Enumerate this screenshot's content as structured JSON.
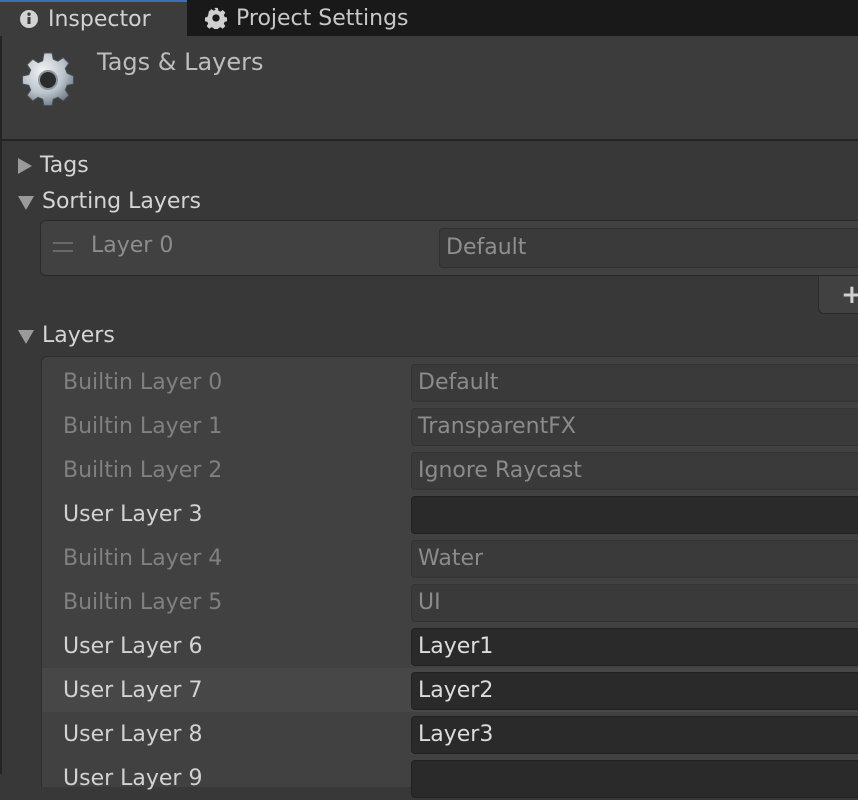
{
  "tabs": [
    {
      "label": "Inspector",
      "icon": "info-icon",
      "active": true
    },
    {
      "label": "Project Settings",
      "icon": "gear-icon",
      "active": false
    }
  ],
  "header": {
    "title": "Tags & Layers",
    "icon": "gear-settings-icon"
  },
  "sections": {
    "tags": {
      "label": "Tags",
      "expanded": false
    },
    "sorting_layers": {
      "label": "Sorting Layers",
      "expanded": true,
      "items": [
        {
          "name": "Layer 0",
          "value": "Default"
        }
      ],
      "add_icon": "plus-icon"
    },
    "layers": {
      "label": "Layers",
      "expanded": true,
      "items": [
        {
          "name": "Builtin Layer 0",
          "value": "Default",
          "builtin": true
        },
        {
          "name": "Builtin Layer 1",
          "value": "TransparentFX",
          "builtin": true
        },
        {
          "name": "Builtin Layer 2",
          "value": "Ignore Raycast",
          "builtin": true
        },
        {
          "name": "User Layer 3",
          "value": "",
          "builtin": false
        },
        {
          "name": "Builtin Layer 4",
          "value": "Water",
          "builtin": true
        },
        {
          "name": "Builtin Layer 5",
          "value": "UI",
          "builtin": true
        },
        {
          "name": "User Layer 6",
          "value": "Layer1",
          "builtin": false
        },
        {
          "name": "User Layer 7",
          "value": "Layer2",
          "builtin": false
        },
        {
          "name": "User Layer 8",
          "value": "Layer3",
          "builtin": false
        },
        {
          "name": "User Layer 9",
          "value": "",
          "builtin": false
        }
      ]
    }
  },
  "colors": {
    "accent": "#3a72b0",
    "background": "#383838",
    "tabbar": "#191919"
  }
}
